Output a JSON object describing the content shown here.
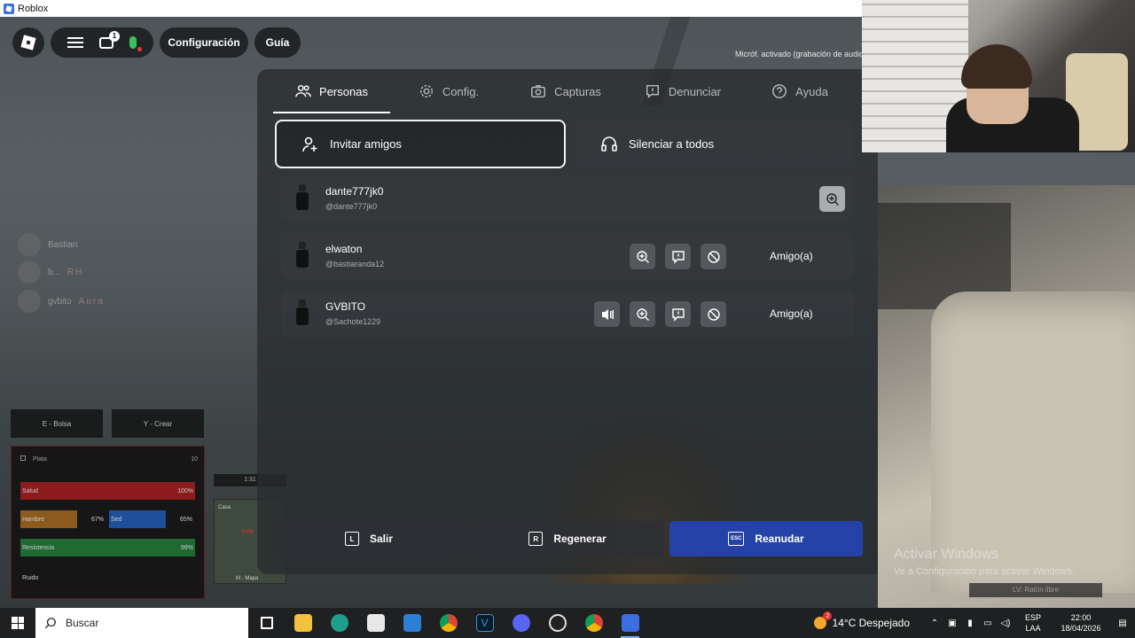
{
  "window": {
    "title": "Roblox"
  },
  "topbar": {
    "config_label": "Configuración",
    "guide_label": "Guía",
    "chat_badge": "1",
    "mic_status": "Micróf. activado (grabación de audio)"
  },
  "side_players": [
    {
      "name": "Bastian",
      "tag": ""
    },
    {
      "name": "b...",
      "tag": "RH"
    },
    {
      "name": "gvbito",
      "tag": "Aura"
    }
  ],
  "hud": {
    "bag_label": "E - Bolsa",
    "craft_label": "Y - Crear",
    "plata_label": "Plata",
    "plata_value": "10",
    "salud_label": "Salud",
    "salud_value": "100%",
    "hambre_label": "Hambre",
    "hambre_value": "67%",
    "sed_label": "Sed",
    "sed_value": "65%",
    "resistencia_label": "Resistencia",
    "resistencia_value": "99%",
    "ruido_label": "Ruido",
    "clock": "1:31",
    "map_label": "M - Mapa",
    "map_place": "Casa",
    "map_player": "GVBI"
  },
  "menu": {
    "tabs": [
      {
        "label": "Personas",
        "icon": "people-icon"
      },
      {
        "label": "Config.",
        "icon": "gear-icon"
      },
      {
        "label": "Capturas",
        "icon": "camera-icon"
      },
      {
        "label": "Denunciar",
        "icon": "report-icon"
      },
      {
        "label": "Ayuda",
        "icon": "help-icon"
      }
    ],
    "invite_label": "Invitar amigos",
    "silence_label": "Silenciar a todos",
    "players": [
      {
        "name": "dante777jk0",
        "handle": "@dante777jk0",
        "relation": ""
      },
      {
        "name": "elwaton",
        "handle": "@bastiaranda12",
        "relation": "Amigo(a)"
      },
      {
        "name": "GVBITO",
        "handle": "@Sachote1229",
        "relation": "Amigo(a)"
      }
    ],
    "buttons": {
      "leave": {
        "key": "L",
        "label": "Salir"
      },
      "reset": {
        "key": "R",
        "label": "Regenerar"
      },
      "resume": {
        "key": "ESC",
        "label": "Reanudar"
      }
    }
  },
  "watermark": {
    "title": "Activar Windows",
    "subtitle": "Ve a Configuración para activar Windows.",
    "mouse_hint": "LV: Ratón libre"
  },
  "taskbar": {
    "search_placeholder": "Buscar",
    "weather_badge": "2",
    "weather": "14°C  Despejado",
    "lang_top": "ESP",
    "lang_bottom": "LAA",
    "time": "22:00",
    "date": "18/04/2026"
  },
  "colors": {
    "resume_button": "#2442a8",
    "mic_active": "#37c25b",
    "health_bar": "#8d1a1c",
    "hunger_bar": "#8a5a1e",
    "thirst_bar": "#1f4f9a",
    "stamina_bar": "#1f6a33"
  }
}
